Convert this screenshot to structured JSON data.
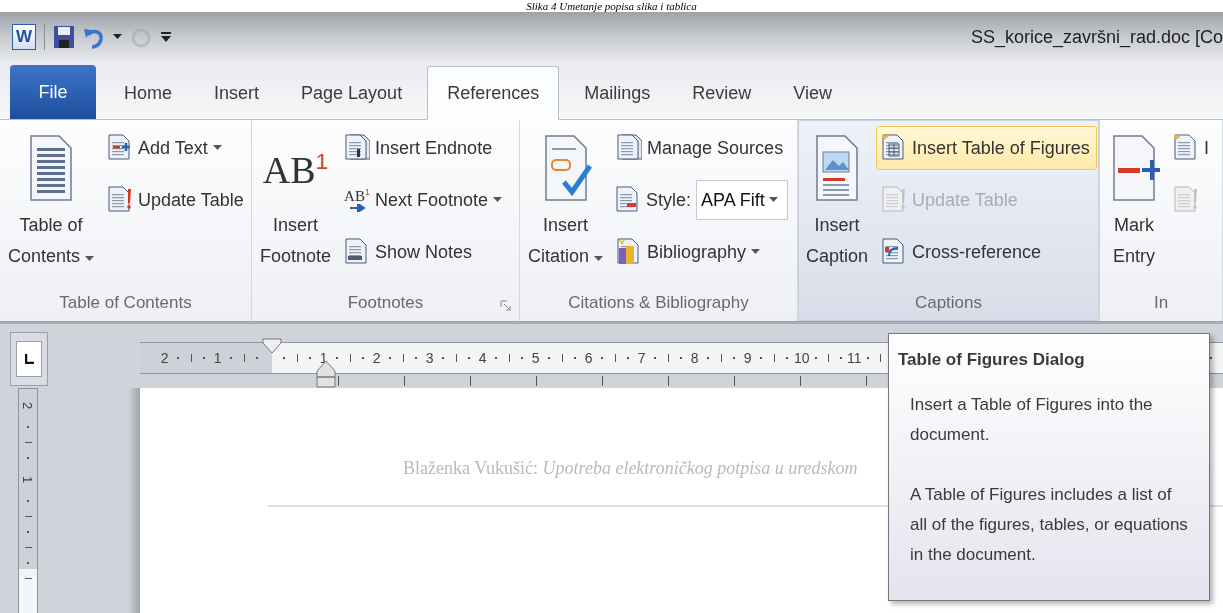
{
  "caption": "Slika 4 Umetanje popisa slika i tablica",
  "window": {
    "app_icon": "W",
    "title": "SS_korice_završni_rad.doc [Co"
  },
  "quick_access": [
    {
      "kind": "save",
      "disabled": false
    },
    {
      "kind": "undo",
      "disabled": false
    },
    {
      "kind": "caret",
      "disabled": false
    },
    {
      "kind": "redo",
      "disabled": true
    },
    {
      "kind": "customize",
      "disabled": false
    }
  ],
  "tabs": [
    {
      "label": "File",
      "kind": "file",
      "selected": false
    },
    {
      "label": "Home",
      "kind": "tab",
      "selected": false
    },
    {
      "label": "Insert",
      "kind": "tab",
      "selected": false
    },
    {
      "label": "Page Layout",
      "kind": "tab",
      "selected": false
    },
    {
      "label": "References",
      "kind": "tab",
      "selected": true
    },
    {
      "label": "Mailings",
      "kind": "tab",
      "selected": false
    },
    {
      "label": "Review",
      "kind": "tab",
      "selected": false
    },
    {
      "label": "View",
      "kind": "tab",
      "selected": false
    }
  ],
  "ribbon": {
    "groups": [
      {
        "label": "Table of Contents",
        "launcher": false,
        "highlighted": false,
        "items": [
          {
            "kind": "large",
            "label": "Table of\nContents",
            "dropdown": true
          },
          {
            "kind": "small",
            "label": "Add Text",
            "dropdown": true,
            "disabled": false,
            "highlighted": false
          },
          {
            "kind": "small",
            "label": "Update Table",
            "dropdown": false,
            "disabled": false,
            "highlighted": false
          }
        ]
      },
      {
        "label": "Footnotes",
        "launcher": true,
        "highlighted": false,
        "items": [
          {
            "kind": "large",
            "label": "Insert\nFootnote",
            "dropdown": false,
            "glyph": "AB$^{1}$"
          },
          {
            "kind": "small",
            "label": "Insert Endnote",
            "dropdown": false,
            "disabled": false,
            "highlighted": false
          },
          {
            "kind": "small",
            "label": "Next Footnote",
            "dropdown": true,
            "disabled": false,
            "highlighted": false,
            "glyph": "AB$^{1}$"
          },
          {
            "kind": "small",
            "label": "Show Notes",
            "dropdown": false,
            "disabled": false,
            "highlighted": false
          }
        ]
      },
      {
        "label": "Citations & Bibliography",
        "launcher": false,
        "highlighted": false,
        "items": [
          {
            "kind": "large",
            "label": "Insert\nCitation",
            "dropdown": true
          },
          {
            "kind": "small",
            "label": "Manage Sources",
            "dropdown": false,
            "disabled": false,
            "highlighted": false
          },
          {
            "kind": "combo",
            "label": "Style:",
            "value": "APA Fift"
          },
          {
            "kind": "small",
            "label": "Bibliography",
            "dropdown": true,
            "disabled": false,
            "highlighted": false
          }
        ]
      },
      {
        "label": "Captions",
        "launcher": false,
        "highlighted": true,
        "items": [
          {
            "kind": "large",
            "label": "Insert\nCaption",
            "dropdown": false
          },
          {
            "kind": "small",
            "label": "Insert Table of Figures",
            "dropdown": false,
            "disabled": false,
            "highlighted": true
          },
          {
            "kind": "small",
            "label": "Update Table",
            "dropdown": false,
            "disabled": true,
            "highlighted": false
          },
          {
            "kind": "small",
            "label": "Cross-reference",
            "dropdown": false,
            "disabled": false,
            "highlighted": false
          }
        ]
      },
      {
        "label": "In",
        "launcher": false,
        "highlighted": false,
        "items": [
          {
            "kind": "large",
            "label": "Mark\nEntry",
            "dropdown": false
          },
          {
            "kind": "small",
            "label": "I",
            "dropdown": false,
            "disabled": false,
            "highlighted": false
          },
          {
            "kind": "small",
            "dropdown": false,
            "disabled": true,
            "highlighted": false
          }
        ]
      }
    ]
  },
  "rulers": {
    "left_numbers": [
      "2",
      "1"
    ],
    "right_numbers": [
      "1",
      "2",
      "3",
      "4",
      "5",
      "6",
      "7",
      "8",
      "9",
      "10",
      "11"
    ],
    "vertical_numbers": [
      "2",
      "1"
    ]
  },
  "document": {
    "header": "Blaženka Vukušić: *Upotreba elektroničkog  potpisa u uredskom*"
  },
  "tooltip": {
    "title": "Table of Figures Dialog",
    "paragraphs": [
      "Insert a Table of Figures into the document.",
      "A Table of Figures includes a list of all of the figures, tables, or equations in the document."
    ]
  }
}
